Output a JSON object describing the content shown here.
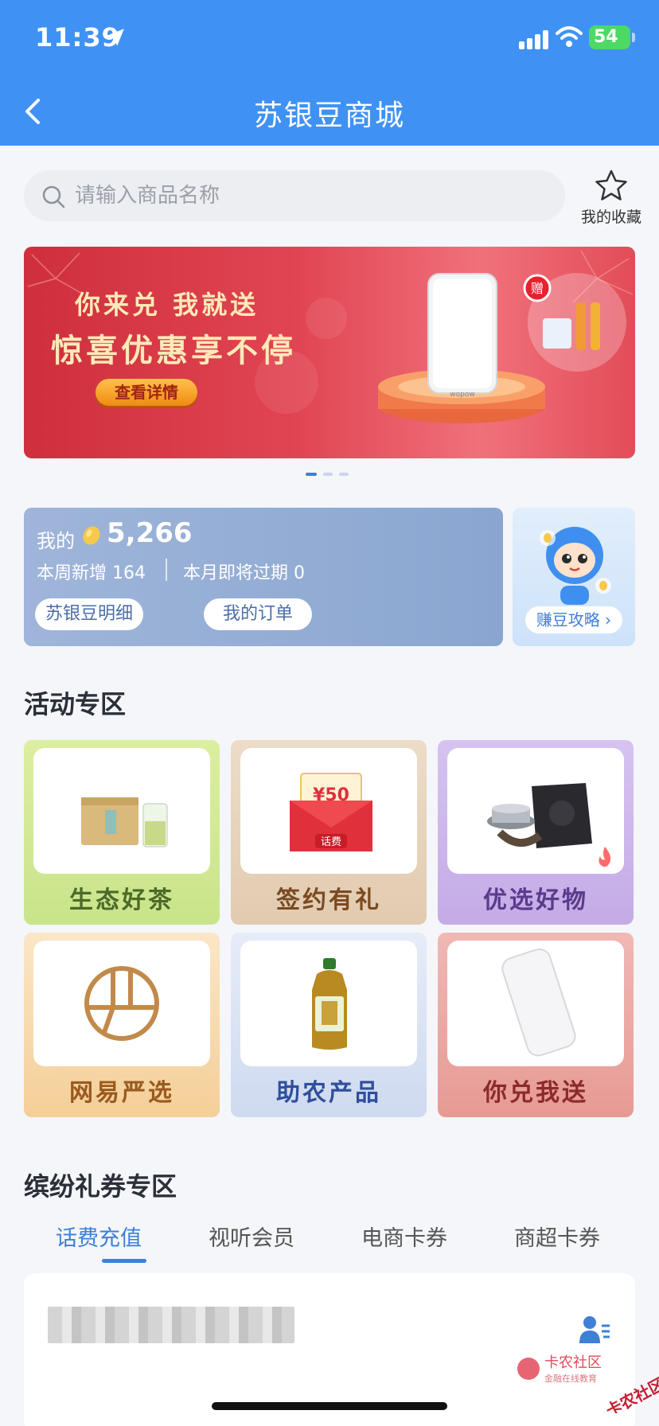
{
  "status_bar": {
    "time": "11:39",
    "battery": "54"
  },
  "header": {
    "title": "苏银豆商城"
  },
  "search": {
    "placeholder": "请输入商品名称"
  },
  "favorites": {
    "label": "我的收藏"
  },
  "banner": {
    "line1": "你来兑 我就送",
    "line2": "惊喜优惠享不停",
    "button": "查看详情",
    "product_brand": "wopow",
    "gift_badge": "赠",
    "dots_total": 3,
    "dots_active": 1
  },
  "points": {
    "mine_label": "我的",
    "balance": "5,266",
    "week_new": "本周新增 164",
    "month_expire": "本月即将过期 0",
    "detail_button": "苏银豆明细",
    "orders_button": "我的订单",
    "guide_button": "赚豆攻略 ›"
  },
  "activity": {
    "title": "活动专区",
    "tiles": [
      {
        "label": "生态好茶"
      },
      {
        "label": "签约有礼",
        "envelope_amount": "¥50",
        "envelope_tag": "话费"
      },
      {
        "label": "优选好物"
      },
      {
        "label": "网易严选"
      },
      {
        "label": "助农产品"
      },
      {
        "label": "你兑我送"
      }
    ]
  },
  "coupons": {
    "title": "缤纷礼券专区",
    "tabs": [
      "话费充值",
      "视听会员",
      "电商卡券",
      "商超卡券"
    ],
    "active_tab": 0
  },
  "watermark": {
    "name": "卡农社区",
    "sub": "金融在线教育",
    "stamp": "卡农社区"
  },
  "colors": {
    "header": "#3f92f4",
    "accent": "#3f7fd6",
    "banner": "#cf2f3c"
  }
}
